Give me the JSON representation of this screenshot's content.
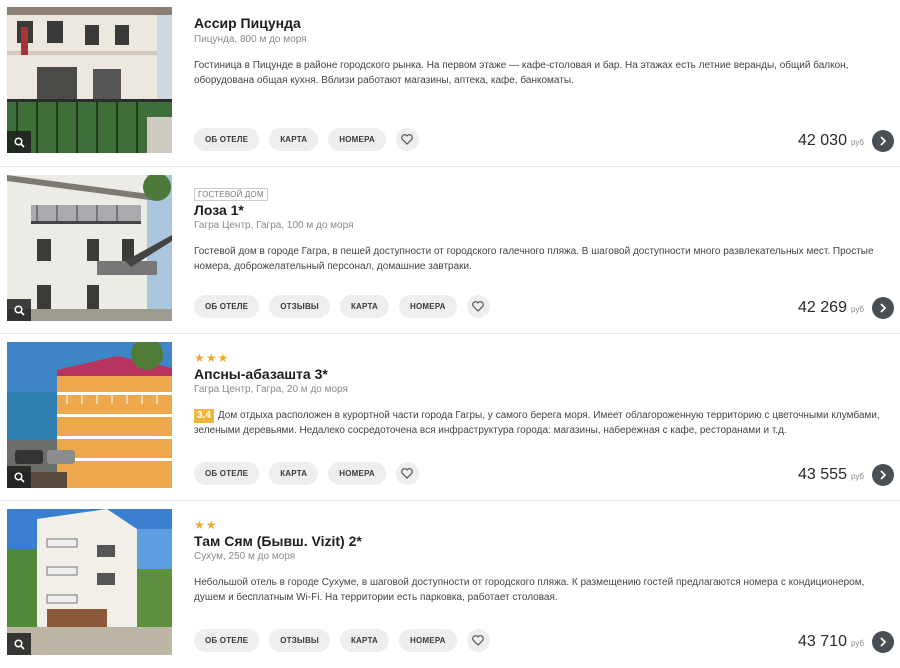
{
  "hotels": [
    {
      "name": "Ассир Пицунда",
      "location": "Пицунда, 800 м до моря",
      "description": "Гостиница в Пицунде в районе городского рынка. На первом этаже — кафе-столовая и бар. На этажах есть летние веранды, общий балкон, оборудована общая кухня. Вблизи работают магазины, аптека, кафе, банкоматы.",
      "buttons": [
        "ОБ ОТЕЛЕ",
        "КАРТА",
        "НОМЕРА"
      ],
      "price": "42 030",
      "currency": "руб"
    },
    {
      "badge": "ГОСТЕВОЙ ДОМ",
      "name": "Лоза 1*",
      "location": "Гагра Центр, Гагра, 100 м до моря",
      "description": "Гостевой дом в городе Гагра, в пешей доступности от городского галечного пляжа. В шаговой доступности много развлекательных мест. Простые номера, доброжелательный персонал, домашние завтраки.",
      "buttons": [
        "ОБ ОТЕЛЕ",
        "ОТЗЫВЫ",
        "КАРТА",
        "НОМЕРА"
      ],
      "price": "42 269",
      "currency": "руб"
    },
    {
      "stars": "★★★",
      "name": "Апсны-абазашта 3*",
      "location": "Гагра Центр, Гагра, 20 м до моря",
      "rating": "3.4",
      "description": "Дом отдыха расположен в курортной части города Гагры, у самого берега моря. Имеет облагороженную территорию с цветочными клумбами, зелеными деревьями. Недалеко сосредоточена вся инфраструктура города: магазины, набережная с кафе, ресторанами и т.д.",
      "buttons": [
        "ОБ ОТЕЛЕ",
        "КАРТА",
        "НОМЕРА"
      ],
      "price": "43 555",
      "currency": "руб"
    },
    {
      "stars": "★★",
      "name": "Там Сям (Бывш. Vizit) 2*",
      "location": "Сухум, 250 м до моря",
      "description": "Небольшой отель в городе Сухуме, в шаговой доступности от городского пляжа. К размещению гостей предлагаются номера с кондиционером, душем и бесплатным Wi-Fi. На территории есть парковка, работает столовая.",
      "buttons": [
        "ОБ ОТЕЛЕ",
        "ОТЗЫВЫ",
        "КАРТА",
        "НОМЕРА"
      ],
      "price": "43 710",
      "currency": "руб"
    }
  ],
  "colors": {
    "star": "#f0a92a",
    "rating": "#f0b53d",
    "button_bg": "#eceef0",
    "go_button": "#4a4f55"
  },
  "icons": {
    "zoom": "magnifier-icon",
    "favorite": "heart-icon",
    "next": "chevron-right-icon"
  }
}
